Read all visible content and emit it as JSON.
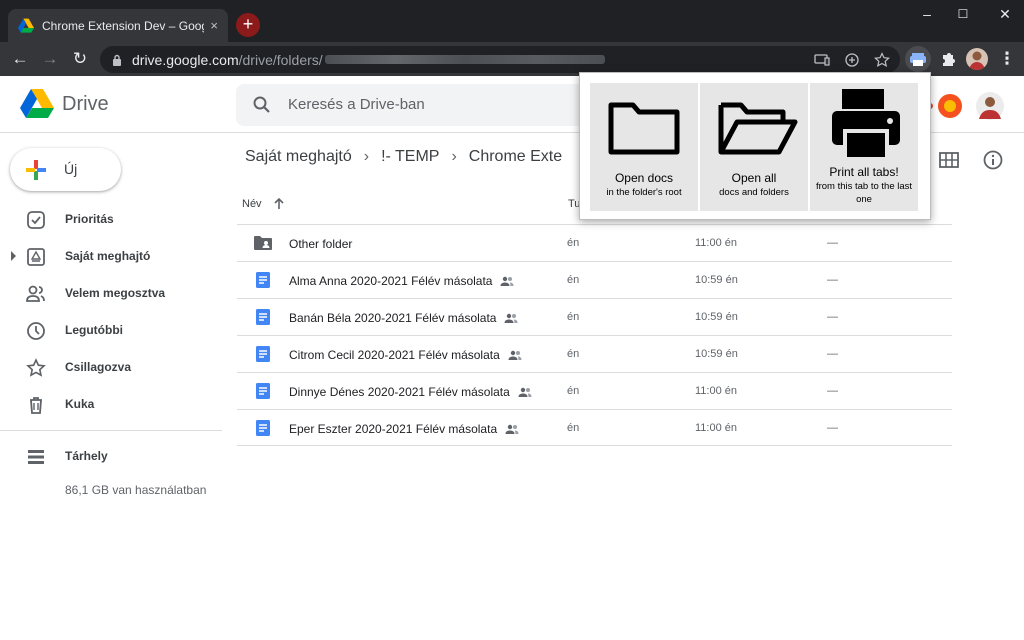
{
  "browser": {
    "tab_title": "Chrome Extension Dev – Google",
    "tab_close": "×",
    "new_tab": "+",
    "url_host": "drive.google.com",
    "url_path": "/drive/folders/",
    "window_controls": {
      "minimize": "–",
      "maximize": "☐",
      "close": "✕"
    },
    "nav": {
      "back": "←",
      "forward": "→",
      "reload": "↻",
      "menu": "⋮"
    }
  },
  "drive": {
    "app_name": "Drive",
    "search_placeholder": "Keresés a Drive-ban",
    "new_button": "Új",
    "sidebar": {
      "items": [
        {
          "label": "Prioritás",
          "icon": "priority-icon"
        },
        {
          "label": "Saját meghajtó",
          "icon": "my-drive-icon"
        },
        {
          "label": "Velem megosztva",
          "icon": "shared-with-me-icon"
        },
        {
          "label": "Legutóbbi",
          "icon": "recent-icon"
        },
        {
          "label": "Csillagozva",
          "icon": "starred-icon"
        },
        {
          "label": "Kuka",
          "icon": "trash-icon"
        }
      ],
      "storage_label": "Tárhely",
      "storage_used": "86,1 GB van használatban"
    },
    "breadcrumb": [
      "Saját meghajtó",
      "!- TEMP",
      "Chrome Exte"
    ],
    "breadcrumb_sep": "›",
    "columns": {
      "name": "Név",
      "owner": "Tu"
    },
    "files": [
      {
        "name": "Other folder",
        "type": "folder",
        "shared": false,
        "owner": "én",
        "modified": "11:00 én",
        "size": "—"
      },
      {
        "name": "Alma Anna 2020-2021 Félév másolata",
        "type": "doc",
        "shared": true,
        "owner": "én",
        "modified": "10:59 én",
        "size": "—"
      },
      {
        "name": "Banán Béla 2020-2021 Félév másolata",
        "type": "doc",
        "shared": true,
        "owner": "én",
        "modified": "10:59 én",
        "size": "—"
      },
      {
        "name": "Citrom Cecil 2020-2021 Félév másolata",
        "type": "doc",
        "shared": true,
        "owner": "én",
        "modified": "10:59 én",
        "size": "—"
      },
      {
        "name": "Dinnye Dénes 2020-2021 Félév másolata",
        "type": "doc",
        "shared": true,
        "owner": "én",
        "modified": "11:00 én",
        "size": "—"
      },
      {
        "name": "Eper Eszter 2020-2021 Félév másolata",
        "type": "doc",
        "shared": true,
        "owner": "én",
        "modified": "11:00 én",
        "size": "—"
      }
    ]
  },
  "extension_popup": {
    "buttons": [
      {
        "title": "Open docs",
        "subtitle": "in the folder's root",
        "icon": "folder-icon"
      },
      {
        "title": "Open all",
        "subtitle": "docs and folders",
        "icon": "folder-open-icon"
      },
      {
        "title": "Print all tabs!",
        "subtitle": "from this tab to the last one",
        "icon": "printer-icon"
      }
    ]
  },
  "colors": {
    "chrome_dark": "#202124",
    "chrome_toolbar": "#35363a",
    "docs_blue": "#4285f4",
    "popup_button_bg": "#e6e6e6"
  }
}
